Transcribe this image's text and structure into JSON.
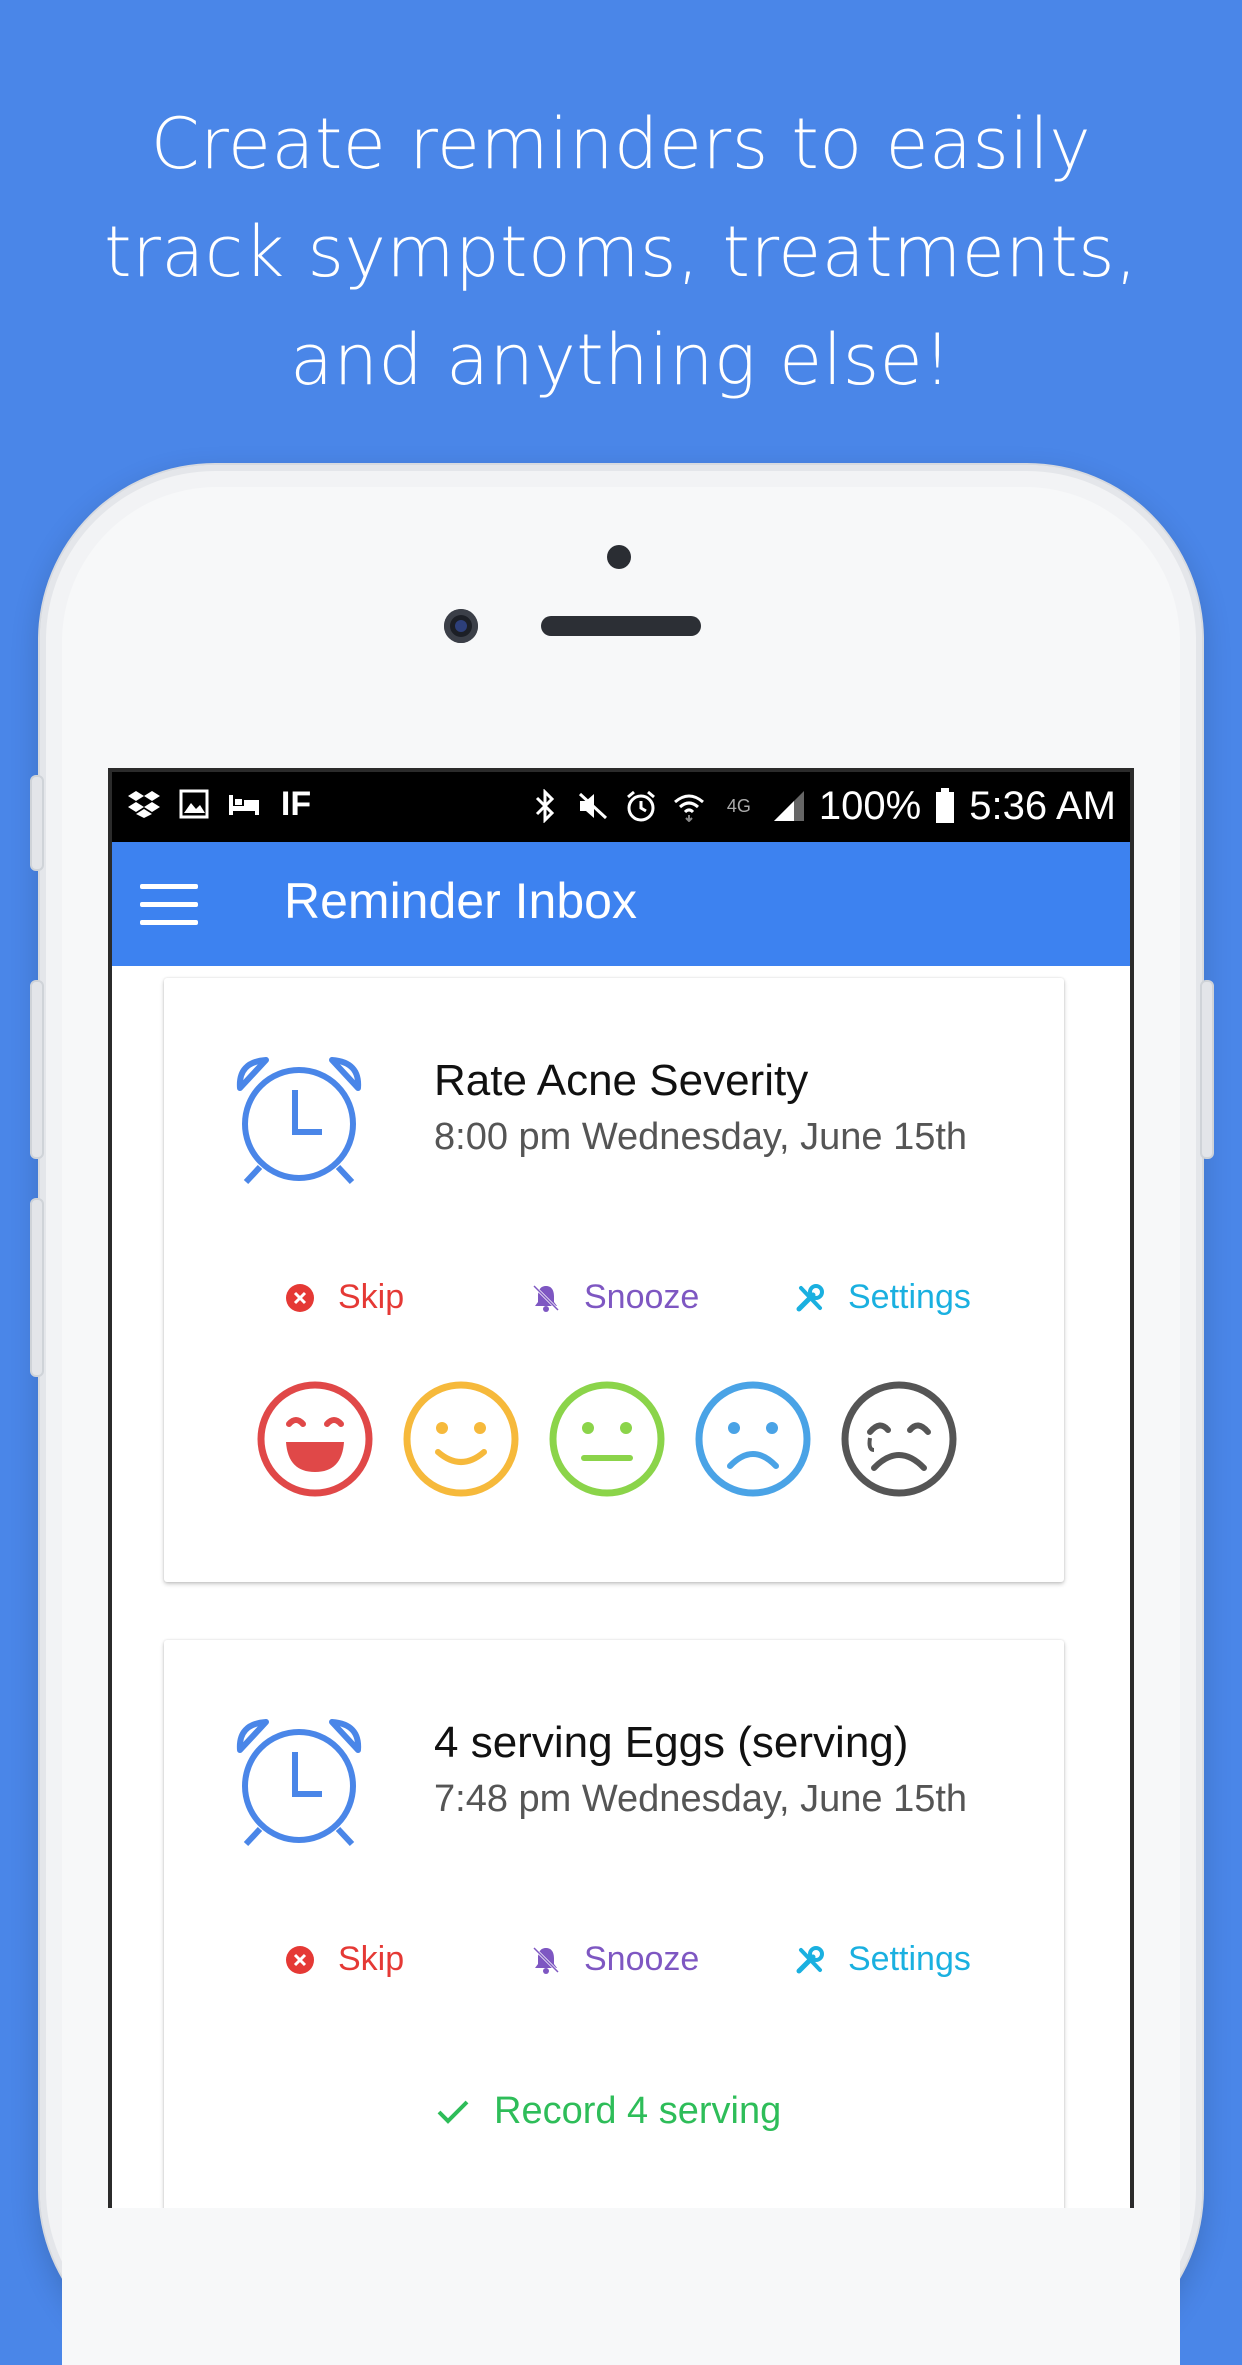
{
  "headline": {
    "line1": "Create reminders to easily",
    "line2": "track symptoms, treatments,",
    "line3": "and anything else!"
  },
  "status_bar": {
    "left_icons": [
      "dropbox-icon",
      "image-icon",
      "bed-icon",
      "ifttt-icon"
    ],
    "right_icons": [
      "bluetooth-icon",
      "mute-icon",
      "alarm-icon",
      "wifi-icon",
      "4g-icon",
      "signal-icon"
    ],
    "battery": "100%",
    "time": "5:36 AM",
    "network": "4G"
  },
  "app_bar": {
    "title": "Reminder Inbox",
    "menu_icon": "hamburger-menu-icon",
    "color": "#3d82f0"
  },
  "reminders": [
    {
      "title": "Rate Acne Severity",
      "time": "8:00 pm Wednesday, June 15th",
      "actions": {
        "skip": "Skip",
        "snooze": "Snooze",
        "settings": "Settings"
      },
      "rating_faces": [
        "very-happy-face-icon",
        "happy-face-icon",
        "neutral-face-icon",
        "sad-face-icon",
        "very-sad-face-icon"
      ]
    },
    {
      "title": "4 serving Eggs (serving)",
      "time": "7:48 pm Wednesday, June 15th",
      "actions": {
        "skip": "Skip",
        "snooze": "Snooze",
        "settings": "Settings"
      },
      "record_label": "Record 4 serving"
    }
  ],
  "colors": {
    "background": "#4a86e8",
    "skip": "#e53935",
    "snooze": "#7e57c2",
    "settings": "#1ab0e0",
    "record": "#2ebd59",
    "alarm_icon": "#4a86e8"
  }
}
